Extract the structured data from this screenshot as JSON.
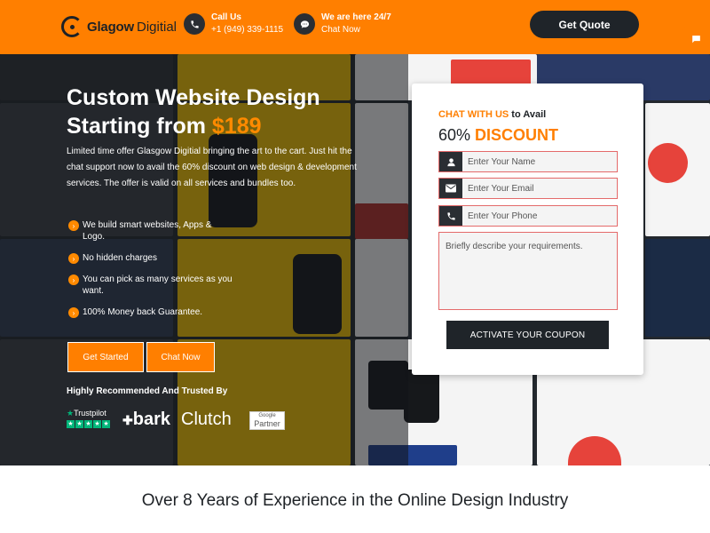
{
  "header": {
    "logo_bold": "Glagow",
    "logo_light": "Digitial",
    "call": {
      "title": "Call Us",
      "number": "+1 (949) 339-1115",
      "icon": "phone-icon"
    },
    "chat": {
      "title": "We are here 24/7",
      "label": "Chat Now",
      "icon": "chat-bubble-icon"
    },
    "quote_button": "Get Quote"
  },
  "side_tabs": [
    {
      "icon": "chat-icon"
    },
    {
      "icon": "phone-icon"
    }
  ],
  "hero": {
    "title_line1": "Custom Website Design",
    "title_line2_prefix": "Starting from ",
    "title_price": "$189",
    "description": "Limited time offer Glasgow Digitial bringing the art to the cart. Just hit the chat support now to avail the 60% discount on web design & development services. The offer is valid on all services and bundles too.",
    "features": [
      "We build smart websites, Apps & Logo.",
      "No hidden charges",
      "You can pick as many services as you want.",
      "100% Money back Guarantee."
    ],
    "buttons": {
      "get_started": "Get Started",
      "chat_now": "Chat Now"
    },
    "trusted_label": "Highly Recommended And Trusted By",
    "badges": {
      "trustpilot": "Trustpilot",
      "bark": "bark",
      "clutch": "Clutch",
      "google_top": "Google",
      "google_bottom": "Partner"
    }
  },
  "form": {
    "heading_accent": "CHAT WITH US",
    "heading_rest": " to Avail",
    "discount_number": "60% ",
    "discount_word": "DISCOUNT",
    "name_placeholder": "Enter Your Name",
    "email_placeholder": "Enter Your Email",
    "phone_placeholder": "Enter Your Phone",
    "requirements_placeholder": "Briefly describe your requirements.",
    "submit": "ACTIVATE YOUR COUPON"
  },
  "section": {
    "heading": "Over 8 Years of Experience in the Online Design Industry"
  },
  "colors": {
    "brand_orange": "#ff7f00",
    "dark": "#1f2429"
  }
}
